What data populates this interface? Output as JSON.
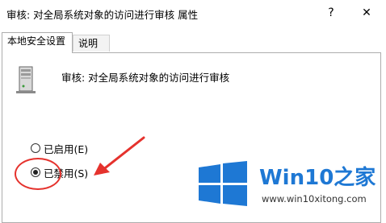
{
  "window": {
    "title": "审核: 对全局系统对象的访问进行审核 属性",
    "help_glyph": "?",
    "close_glyph": "✕"
  },
  "tabs": [
    {
      "label": "本地安全设置",
      "active": true
    },
    {
      "label": "说明",
      "active": false
    }
  ],
  "policy": {
    "icon": "server-icon",
    "name": "审核: 对全局系统对象的访问进行审核"
  },
  "options": [
    {
      "label": "已启用(E)",
      "checked": false
    },
    {
      "label": "已禁用(S)",
      "checked": true
    }
  ],
  "annotations": {
    "color": "#e5322d"
  },
  "watermark": {
    "brand": "Win10",
    "suffix": "之家",
    "url": "www.win10xitong.com",
    "brand_color": "#1e78d4"
  }
}
